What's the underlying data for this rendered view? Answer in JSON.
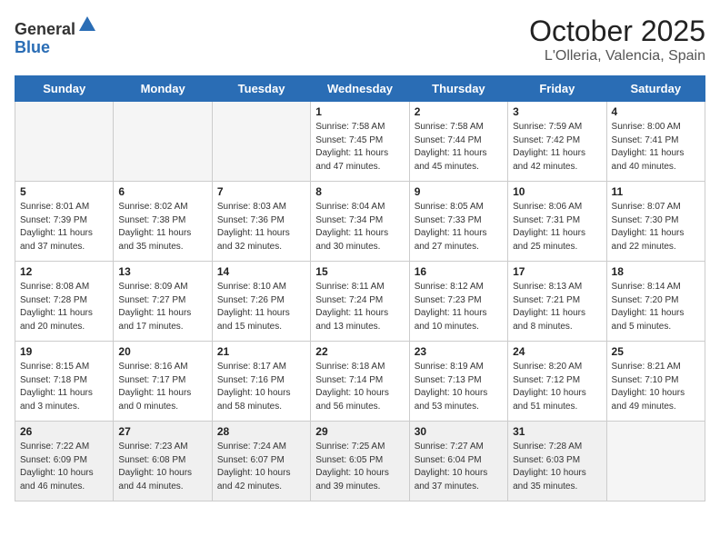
{
  "header": {
    "logo_line1": "General",
    "logo_line2": "Blue",
    "title": "October 2025",
    "subtitle": "L'Olleria, Valencia, Spain"
  },
  "calendar": {
    "days_of_week": [
      "Sunday",
      "Monday",
      "Tuesday",
      "Wednesday",
      "Thursday",
      "Friday",
      "Saturday"
    ],
    "weeks": [
      [
        {
          "day": "",
          "sunrise": "",
          "sunset": "",
          "daylight": "",
          "empty": true
        },
        {
          "day": "",
          "sunrise": "",
          "sunset": "",
          "daylight": "",
          "empty": true
        },
        {
          "day": "",
          "sunrise": "",
          "sunset": "",
          "daylight": "",
          "empty": true
        },
        {
          "day": "1",
          "sunrise": "Sunrise: 7:58 AM",
          "sunset": "Sunset: 7:45 PM",
          "daylight": "Daylight: 11 hours and 47 minutes."
        },
        {
          "day": "2",
          "sunrise": "Sunrise: 7:58 AM",
          "sunset": "Sunset: 7:44 PM",
          "daylight": "Daylight: 11 hours and 45 minutes."
        },
        {
          "day": "3",
          "sunrise": "Sunrise: 7:59 AM",
          "sunset": "Sunset: 7:42 PM",
          "daylight": "Daylight: 11 hours and 42 minutes."
        },
        {
          "day": "4",
          "sunrise": "Sunrise: 8:00 AM",
          "sunset": "Sunset: 7:41 PM",
          "daylight": "Daylight: 11 hours and 40 minutes."
        }
      ],
      [
        {
          "day": "5",
          "sunrise": "Sunrise: 8:01 AM",
          "sunset": "Sunset: 7:39 PM",
          "daylight": "Daylight: 11 hours and 37 minutes."
        },
        {
          "day": "6",
          "sunrise": "Sunrise: 8:02 AM",
          "sunset": "Sunset: 7:38 PM",
          "daylight": "Daylight: 11 hours and 35 minutes."
        },
        {
          "day": "7",
          "sunrise": "Sunrise: 8:03 AM",
          "sunset": "Sunset: 7:36 PM",
          "daylight": "Daylight: 11 hours and 32 minutes."
        },
        {
          "day": "8",
          "sunrise": "Sunrise: 8:04 AM",
          "sunset": "Sunset: 7:34 PM",
          "daylight": "Daylight: 11 hours and 30 minutes."
        },
        {
          "day": "9",
          "sunrise": "Sunrise: 8:05 AM",
          "sunset": "Sunset: 7:33 PM",
          "daylight": "Daylight: 11 hours and 27 minutes."
        },
        {
          "day": "10",
          "sunrise": "Sunrise: 8:06 AM",
          "sunset": "Sunset: 7:31 PM",
          "daylight": "Daylight: 11 hours and 25 minutes."
        },
        {
          "day": "11",
          "sunrise": "Sunrise: 8:07 AM",
          "sunset": "Sunset: 7:30 PM",
          "daylight": "Daylight: 11 hours and 22 minutes."
        }
      ],
      [
        {
          "day": "12",
          "sunrise": "Sunrise: 8:08 AM",
          "sunset": "Sunset: 7:28 PM",
          "daylight": "Daylight: 11 hours and 20 minutes."
        },
        {
          "day": "13",
          "sunrise": "Sunrise: 8:09 AM",
          "sunset": "Sunset: 7:27 PM",
          "daylight": "Daylight: 11 hours and 17 minutes."
        },
        {
          "day": "14",
          "sunrise": "Sunrise: 8:10 AM",
          "sunset": "Sunset: 7:26 PM",
          "daylight": "Daylight: 11 hours and 15 minutes."
        },
        {
          "day": "15",
          "sunrise": "Sunrise: 8:11 AM",
          "sunset": "Sunset: 7:24 PM",
          "daylight": "Daylight: 11 hours and 13 minutes."
        },
        {
          "day": "16",
          "sunrise": "Sunrise: 8:12 AM",
          "sunset": "Sunset: 7:23 PM",
          "daylight": "Daylight: 11 hours and 10 minutes."
        },
        {
          "day": "17",
          "sunrise": "Sunrise: 8:13 AM",
          "sunset": "Sunset: 7:21 PM",
          "daylight": "Daylight: 11 hours and 8 minutes."
        },
        {
          "day": "18",
          "sunrise": "Sunrise: 8:14 AM",
          "sunset": "Sunset: 7:20 PM",
          "daylight": "Daylight: 11 hours and 5 minutes."
        }
      ],
      [
        {
          "day": "19",
          "sunrise": "Sunrise: 8:15 AM",
          "sunset": "Sunset: 7:18 PM",
          "daylight": "Daylight: 11 hours and 3 minutes."
        },
        {
          "day": "20",
          "sunrise": "Sunrise: 8:16 AM",
          "sunset": "Sunset: 7:17 PM",
          "daylight": "Daylight: 11 hours and 0 minutes."
        },
        {
          "day": "21",
          "sunrise": "Sunrise: 8:17 AM",
          "sunset": "Sunset: 7:16 PM",
          "daylight": "Daylight: 10 hours and 58 minutes."
        },
        {
          "day": "22",
          "sunrise": "Sunrise: 8:18 AM",
          "sunset": "Sunset: 7:14 PM",
          "daylight": "Daylight: 10 hours and 56 minutes."
        },
        {
          "day": "23",
          "sunrise": "Sunrise: 8:19 AM",
          "sunset": "Sunset: 7:13 PM",
          "daylight": "Daylight: 10 hours and 53 minutes."
        },
        {
          "day": "24",
          "sunrise": "Sunrise: 8:20 AM",
          "sunset": "Sunset: 7:12 PM",
          "daylight": "Daylight: 10 hours and 51 minutes."
        },
        {
          "day": "25",
          "sunrise": "Sunrise: 8:21 AM",
          "sunset": "Sunset: 7:10 PM",
          "daylight": "Daylight: 10 hours and 49 minutes."
        }
      ],
      [
        {
          "day": "26",
          "sunrise": "Sunrise: 7:22 AM",
          "sunset": "Sunset: 6:09 PM",
          "daylight": "Daylight: 10 hours and 46 minutes.",
          "last": true
        },
        {
          "day": "27",
          "sunrise": "Sunrise: 7:23 AM",
          "sunset": "Sunset: 6:08 PM",
          "daylight": "Daylight: 10 hours and 44 minutes.",
          "last": true
        },
        {
          "day": "28",
          "sunrise": "Sunrise: 7:24 AM",
          "sunset": "Sunset: 6:07 PM",
          "daylight": "Daylight: 10 hours and 42 minutes.",
          "last": true
        },
        {
          "day": "29",
          "sunrise": "Sunrise: 7:25 AM",
          "sunset": "Sunset: 6:05 PM",
          "daylight": "Daylight: 10 hours and 39 minutes.",
          "last": true
        },
        {
          "day": "30",
          "sunrise": "Sunrise: 7:27 AM",
          "sunset": "Sunset: 6:04 PM",
          "daylight": "Daylight: 10 hours and 37 minutes.",
          "last": true
        },
        {
          "day": "31",
          "sunrise": "Sunrise: 7:28 AM",
          "sunset": "Sunset: 6:03 PM",
          "daylight": "Daylight: 10 hours and 35 minutes.",
          "last": true
        },
        {
          "day": "",
          "sunrise": "",
          "sunset": "",
          "daylight": "",
          "empty": true,
          "last": true
        }
      ]
    ]
  }
}
